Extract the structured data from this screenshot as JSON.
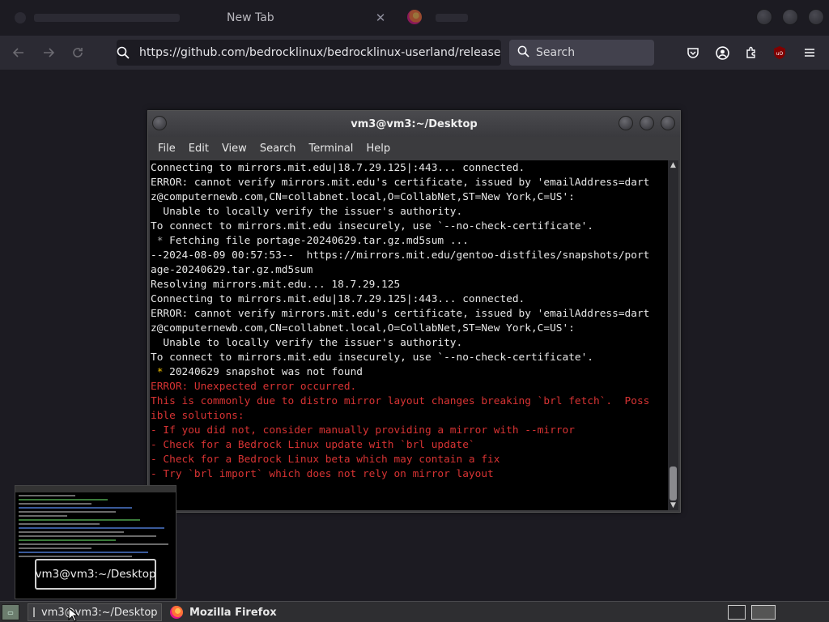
{
  "browser": {
    "tabs": [
      {
        "label": "New Tab",
        "active": true
      }
    ],
    "url": "https://github.com/bedrocklinux/bedrocklinux-userland/releases/do",
    "search_placeholder": "Search",
    "toolbar_icons": [
      "pocket-icon",
      "account-icon",
      "extensions-icon",
      "ublock-icon",
      "menu-icon"
    ]
  },
  "terminal": {
    "title": "vm3@vm3:~/Desktop",
    "menu": [
      "File",
      "Edit",
      "View",
      "Search",
      "Terminal",
      "Help"
    ],
    "lines": [
      {
        "text": "Connecting to mirrors.mit.edu|18.7.29.125|:443... connected.",
        "kind": "normal"
      },
      {
        "text": "ERROR: cannot verify mirrors.mit.edu's certificate, issued by 'emailAddress=dart",
        "kind": "normal"
      },
      {
        "text": "z@computernewb.com,CN=collabnet.local,O=CollabNet,ST=New York,C=US':",
        "kind": "normal"
      },
      {
        "text": "  Unable to locally verify the issuer's authority.",
        "kind": "normal"
      },
      {
        "text": "To connect to mirrors.mit.edu insecurely, use `--no-check-certificate'.",
        "kind": "normal"
      },
      {
        "text": " * Fetching file portage-20240629.tar.gz.md5sum ...",
        "kind": "dimstar"
      },
      {
        "text": "--2024-08-09 00:57:53--  https://mirrors.mit.edu/gentoo-distfiles/snapshots/port",
        "kind": "normal"
      },
      {
        "text": "age-20240629.tar.gz.md5sum",
        "kind": "normal"
      },
      {
        "text": "Resolving mirrors.mit.edu... 18.7.29.125",
        "kind": "normal"
      },
      {
        "text": "Connecting to mirrors.mit.edu|18.7.29.125|:443... connected.",
        "kind": "normal"
      },
      {
        "text": "ERROR: cannot verify mirrors.mit.edu's certificate, issued by 'emailAddress=dart",
        "kind": "normal"
      },
      {
        "text": "z@computernewb.com,CN=collabnet.local,O=CollabNet,ST=New York,C=US':",
        "kind": "normal"
      },
      {
        "text": "  Unable to locally verify the issuer's authority.",
        "kind": "normal"
      },
      {
        "text": "To connect to mirrors.mit.edu insecurely, use `--no-check-certificate'.",
        "kind": "normal"
      },
      {
        "text": " * 20240629 snapshot was not found",
        "kind": "star"
      },
      {
        "text": "ERROR: Unexpected error occurred.",
        "kind": "err"
      },
      {
        "text": "This is commonly due to distro mirror layout changes breaking `brl fetch`.  Poss",
        "kind": "err"
      },
      {
        "text": "ible solutions:",
        "kind": "err"
      },
      {
        "text": "- If you did not, consider manually providing a mirror with --mirror",
        "kind": "err"
      },
      {
        "text": "- Check for a Bedrock Linux update with `brl update`",
        "kind": "err"
      },
      {
        "text": "- Check for a Bedrock Linux beta which may contain a fix",
        "kind": "err"
      },
      {
        "text": "- Try `brl import` which does not rely on mirror layout",
        "kind": "err"
      }
    ]
  },
  "tooltip": {
    "text": "vm3@vm3:~/Desktop"
  },
  "taskbar": {
    "items": [
      {
        "label": "vm3@vm3:~/Desktop",
        "active": true
      },
      {
        "label": "Mozilla Firefox",
        "active": false
      }
    ]
  },
  "colors": {
    "error_red": "#d73333",
    "star_yellow": "#f0c000",
    "browser_bg": "#1c1b22",
    "toolbar_bg": "#2b2a33"
  }
}
